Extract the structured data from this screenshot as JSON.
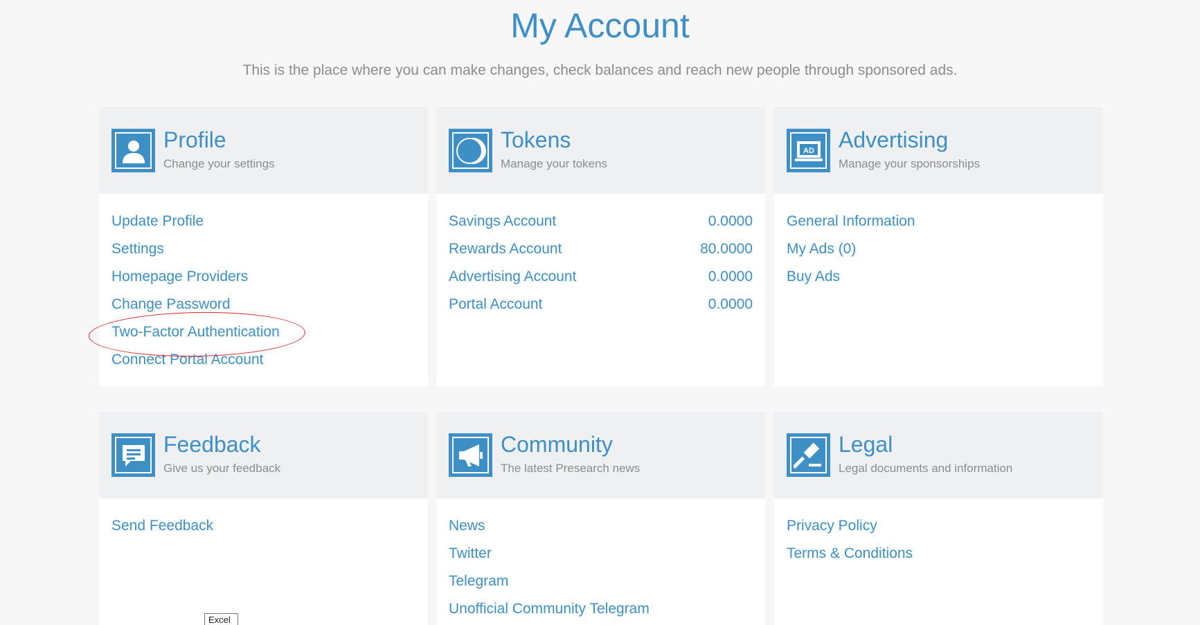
{
  "header": {
    "title": "My Account",
    "subtitle": "This is the place where you can make changes, check balances and reach new people through sponsored ads."
  },
  "cards": {
    "profile": {
      "title": "Profile",
      "subtitle": "Change your settings",
      "icon": "user-icon",
      "items": [
        {
          "label": "Update Profile"
        },
        {
          "label": "Settings"
        },
        {
          "label": "Homepage Providers"
        },
        {
          "label": "Change Password"
        },
        {
          "label": "Two-Factor Authentication"
        },
        {
          "label": "Connect Portal Account"
        }
      ]
    },
    "tokens": {
      "title": "Tokens",
      "subtitle": "Manage your tokens",
      "icon": "coin-icon",
      "items": [
        {
          "label": "Savings Account",
          "value": "0.0000"
        },
        {
          "label": "Rewards Account",
          "value": "80.0000"
        },
        {
          "label": "Advertising Account",
          "value": "0.0000"
        },
        {
          "label": "Portal Account",
          "value": "0.0000"
        }
      ]
    },
    "advertising": {
      "title": "Advertising",
      "subtitle": "Manage your sponsorships",
      "icon": "ad-icon",
      "icon_text": "AD",
      "items": [
        {
          "label": "General Information"
        },
        {
          "label": "My Ads (0)"
        },
        {
          "label": "Buy Ads"
        }
      ]
    },
    "feedback": {
      "title": "Feedback",
      "subtitle": "Give us your feedback",
      "icon": "chat-icon",
      "items": [
        {
          "label": "Send Feedback"
        }
      ]
    },
    "community": {
      "title": "Community",
      "subtitle": "The latest Presearch news",
      "icon": "megaphone-icon",
      "items": [
        {
          "label": "News"
        },
        {
          "label": "Twitter"
        },
        {
          "label": "Telegram"
        },
        {
          "label": "Unofficial Community Telegram"
        }
      ]
    },
    "legal": {
      "title": "Legal",
      "subtitle": "Legal documents and information",
      "icon": "gavel-icon",
      "items": [
        {
          "label": "Privacy Policy"
        },
        {
          "label": "Terms & Conditions"
        }
      ]
    }
  },
  "tooltip": {
    "label": "Excel"
  },
  "colors": {
    "accent": "#3d8fc6",
    "muted_text": "#8c8c8c",
    "card_header_bg": "#eef0f2",
    "page_bg": "#f7f7f7",
    "annotation": "#d9262b"
  }
}
